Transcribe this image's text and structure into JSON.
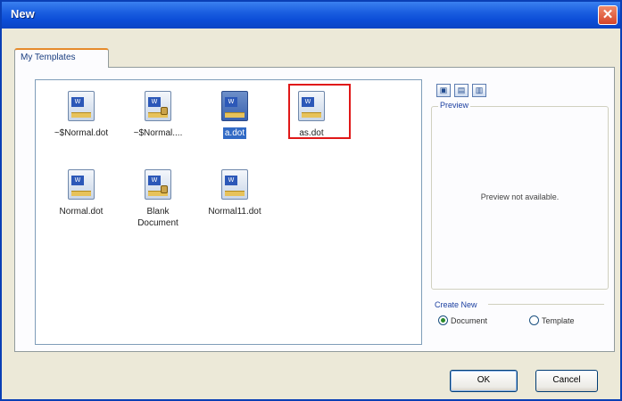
{
  "window": {
    "title": "New",
    "close_glyph": "✕"
  },
  "tabs": [
    {
      "label": "My Templates",
      "active": true
    }
  ],
  "templates": [
    {
      "label": "~$Normal.dot",
      "icon": "word-document-icon",
      "locked": false,
      "selected": false
    },
    {
      "label": "~$Normal....",
      "icon": "word-document-icon",
      "locked": true,
      "selected": false
    },
    {
      "label": "a.dot",
      "icon": "word-document-icon",
      "locked": false,
      "selected": true
    },
    {
      "label": "as.dot",
      "icon": "word-document-icon",
      "locked": false,
      "selected": false,
      "highlighted": true
    },
    {
      "label": "Normal.dot",
      "icon": "word-document-icon",
      "locked": false,
      "selected": false
    },
    {
      "label": "Blank Document",
      "icon": "word-document-icon",
      "locked": true,
      "selected": false
    },
    {
      "label": "Normal11.dot",
      "icon": "word-document-icon",
      "locked": false,
      "selected": false
    }
  ],
  "view_buttons": [
    {
      "name": "large-icons-view-icon",
      "glyph": "▣"
    },
    {
      "name": "list-view-icon",
      "glyph": "▤"
    },
    {
      "name": "details-view-icon",
      "glyph": "▥"
    }
  ],
  "preview": {
    "label": "Preview",
    "message": "Preview not available."
  },
  "create_new": {
    "label": "Create New",
    "options": [
      {
        "label": "Document",
        "checked": true
      },
      {
        "label": "Template",
        "checked": false
      }
    ]
  },
  "buttons": {
    "ok": "OK",
    "cancel": "Cancel"
  },
  "colors": {
    "titlebar": "#0b4cd6",
    "selection": "#316ac5",
    "highlight_box": "#e01818"
  }
}
